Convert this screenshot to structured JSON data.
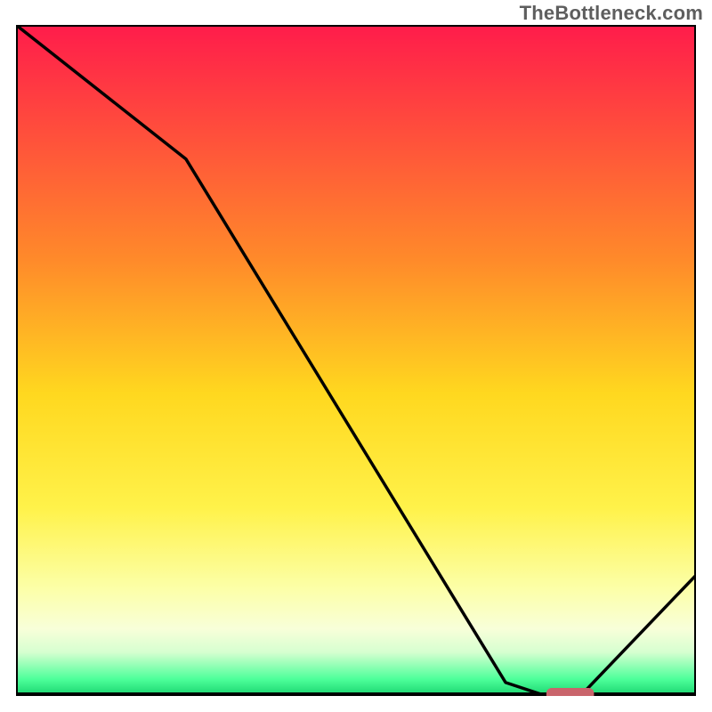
{
  "watermark": "TheBottleneck.com",
  "chart_data": {
    "type": "line",
    "title": "",
    "xlabel": "",
    "ylabel": "",
    "xlim": [
      0,
      100
    ],
    "ylim": [
      0,
      100
    ],
    "curve": {
      "name": "bottleneck-curve",
      "x": [
        0,
        25,
        72,
        78,
        83,
        100
      ],
      "y": [
        100,
        80,
        2,
        0,
        0,
        18
      ]
    },
    "optimal_region": {
      "x_start": 78,
      "x_end": 83,
      "y": 0
    },
    "marker": {
      "x_start": 78,
      "x_end": 85,
      "y": 0,
      "color": "#c9646b"
    },
    "gradient_stops": [
      {
        "offset": 0,
        "color": "#ff1c4b"
      },
      {
        "offset": 0.35,
        "color": "#ff8a2a"
      },
      {
        "offset": 0.55,
        "color": "#ffd81f"
      },
      {
        "offset": 0.72,
        "color": "#fff24a"
      },
      {
        "offset": 0.84,
        "color": "#fcffa8"
      },
      {
        "offset": 0.9,
        "color": "#f8ffd9"
      },
      {
        "offset": 0.935,
        "color": "#d6ffd0"
      },
      {
        "offset": 0.975,
        "color": "#4dff9a"
      },
      {
        "offset": 1.0,
        "color": "#18d36e"
      }
    ],
    "border_color": "#000000"
  }
}
